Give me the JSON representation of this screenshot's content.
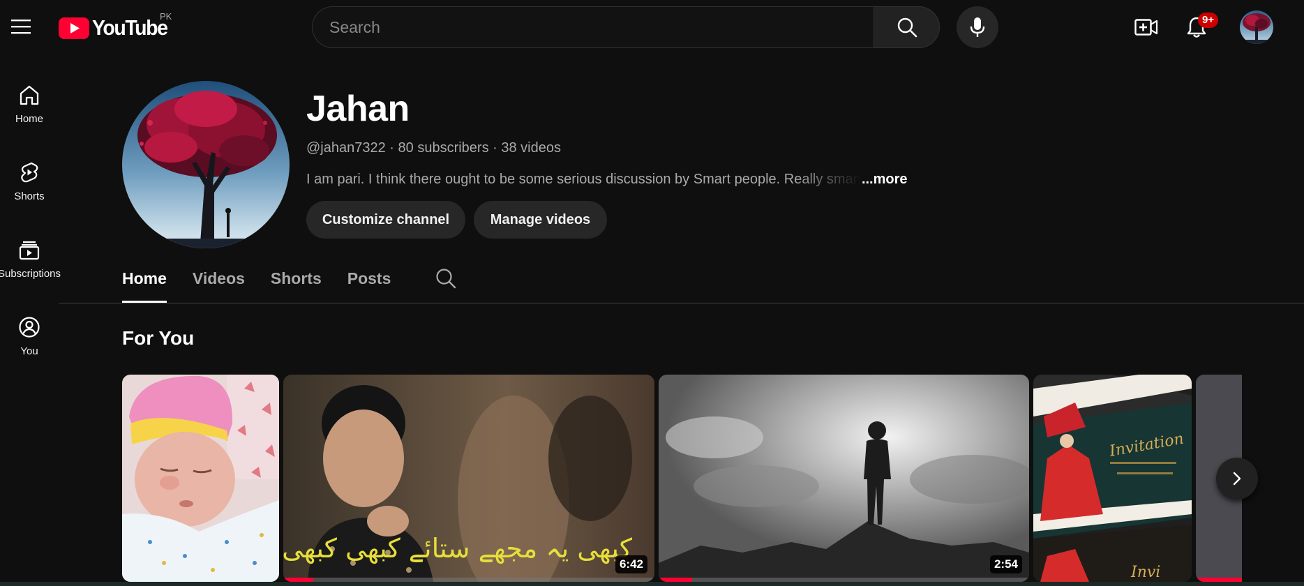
{
  "masthead": {
    "logo_text": "YouTube",
    "country_code": "PK",
    "search_placeholder": "Search",
    "notification_badge": "9+"
  },
  "guide": {
    "items": [
      {
        "label": "Home",
        "icon": "home-icon"
      },
      {
        "label": "Shorts",
        "icon": "shorts-icon"
      },
      {
        "label": "Subscriptions",
        "icon": "subscriptions-icon"
      },
      {
        "label": "You",
        "icon": "you-icon"
      }
    ]
  },
  "channel": {
    "name": "Jahan",
    "handle": "@jahan7322",
    "subscribers": "80 subscribers",
    "videos": "38 videos",
    "separator": " · ",
    "description": "I am pari. I think there ought to be some serious discussion by Smart people. Really smart",
    "more_label": "...more",
    "customize_label": "Customize channel",
    "manage_label": "Manage videos"
  },
  "tabs": [
    {
      "label": "Home",
      "active": true
    },
    {
      "label": "Videos",
      "active": false
    },
    {
      "label": "Shorts",
      "active": false
    },
    {
      "label": "Posts",
      "active": false
    }
  ],
  "section": {
    "title": "For You"
  },
  "shelf": {
    "videos": [
      {
        "thumbnail": "newborn-baby",
        "duration": ""
      },
      {
        "thumbnail": "singer-portrait-urdu-lyrics",
        "duration": "6:42",
        "progress": 0.08
      },
      {
        "thumbnail": "silhouette-on-mountain",
        "duration": "2:54",
        "progress": 0.09
      },
      {
        "thumbnail": "wedding-invitation-cards",
        "duration": ""
      }
    ]
  },
  "colors": {
    "background": "#0f0f0f",
    "brand_red": "#ff0033",
    "badge_red": "#cc0000",
    "pill_bg": "#272727"
  }
}
